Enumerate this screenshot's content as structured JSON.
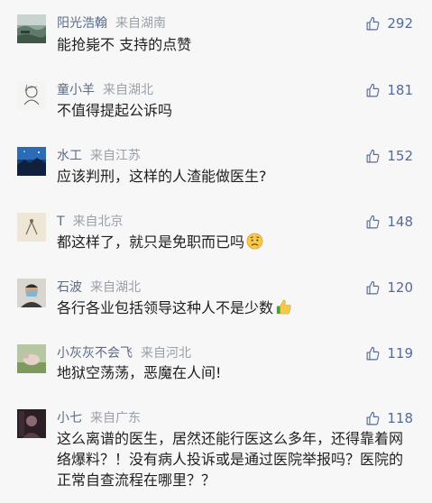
{
  "colors": {
    "author": "#5b6b86",
    "location": "#9aa0a8",
    "likes": "#576b95",
    "text": "#1f1f1f"
  },
  "comments": [
    {
      "author": "阳光浩翰",
      "location": "来自湖南",
      "likes": "292",
      "text": "能抢毙不 支持的点赞",
      "avatar_icon": "landscape-avatar"
    },
    {
      "author": "童小羊",
      "location": "来自湖北",
      "likes": "181",
      "text": "不值得提起公诉吗",
      "avatar_icon": "sketch-portrait-avatar"
    },
    {
      "author": "水工",
      "location": "来自江苏",
      "likes": "152",
      "text": "应该判刑，这样的人渣能做医生?",
      "avatar_icon": "night-sky-avatar"
    },
    {
      "author": "T",
      "location": "来自北京",
      "likes": "148",
      "text": "都这样了，就只是免职而已吗",
      "avatar_icon": "sketch-avatar",
      "emoji": "worried-face-emoji"
    },
    {
      "author": "石波",
      "location": "来自湖北",
      "likes": "120",
      "text": "各行各业包括领导这种人不是少数",
      "avatar_icon": "masked-person-avatar",
      "emoji": "thumbs-up-emoji"
    },
    {
      "author": "小灰灰不会飞",
      "location": "来自河北",
      "likes": "119",
      "text": "地狱空荡荡，恶魔在人间!",
      "avatar_icon": "animal-avatar"
    },
    {
      "author": "小七",
      "location": "来自广东",
      "likes": "118",
      "text": "这么离谱的医生，居然还能行医这么多年，还得靠着网络爆料？！没有病人投诉或是通过医院举报吗？医院的正常自查流程在哪里？？",
      "avatar_icon": "dark-portrait-avatar"
    }
  ]
}
